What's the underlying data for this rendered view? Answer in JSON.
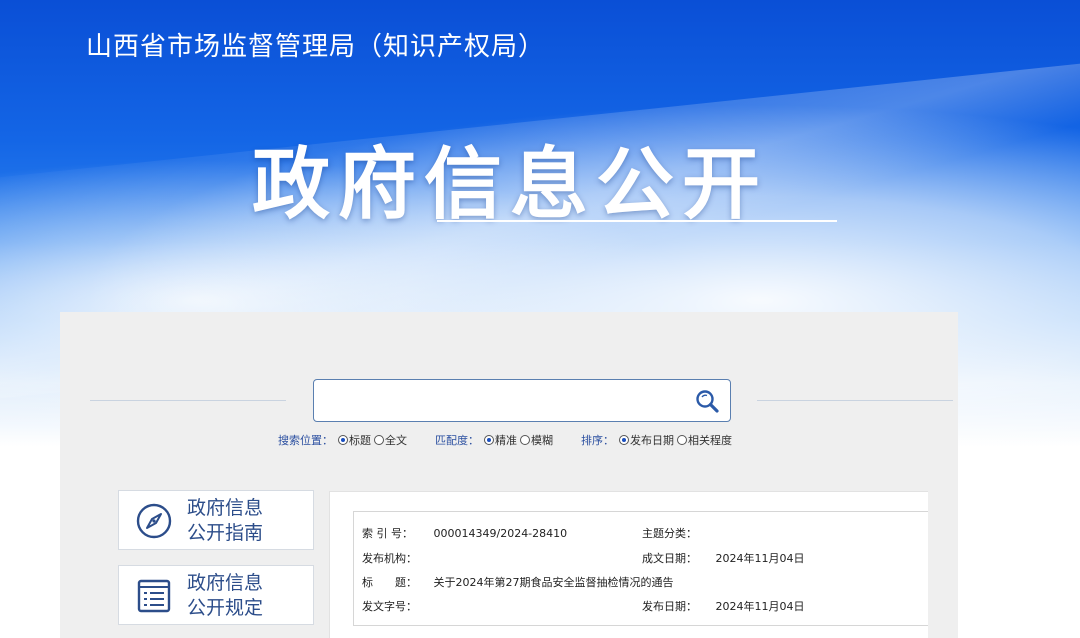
{
  "header": {
    "site_title": "山西省市场监督管理局（知识产权局）",
    "page_title": "政府信息公开"
  },
  "search": {
    "placeholder": "",
    "options": {
      "position_label": "搜索位置：",
      "position_items": [
        {
          "label": "标题",
          "selected": true
        },
        {
          "label": "全文",
          "selected": false
        }
      ],
      "match_label": "匹配度：",
      "match_items": [
        {
          "label": "精准",
          "selected": true
        },
        {
          "label": "模糊",
          "selected": false
        }
      ],
      "sort_label": "排序：",
      "sort_items": [
        {
          "label": "发布日期",
          "selected": true
        },
        {
          "label": "相关程度",
          "selected": false
        }
      ]
    }
  },
  "sidebar": {
    "items": [
      {
        "line1": "政府信息",
        "line2": "公开指南",
        "icon": "compass-icon"
      },
      {
        "line1": "政府信息",
        "line2": "公开规定",
        "icon": "document-list-icon"
      }
    ]
  },
  "detail": {
    "index_no_label": "索 引 号：",
    "index_no": "000014349/2024-28410",
    "topic_label": "主题分类：",
    "topic": "",
    "publisher_label": "发布机构：",
    "publisher": "",
    "written_date_label": "成文日期：",
    "written_date": "2024年11月04日",
    "title_label": "标　　题：",
    "title": "关于2024年第27期食品安全监督抽检情况的通告",
    "doc_no_label": "发文字号：",
    "doc_no": "",
    "publish_date_label": "发布日期：",
    "publish_date": "2024年11月04日"
  },
  "colors": {
    "brand_blue": "#1466e6",
    "label_blue": "#2c4d8a"
  }
}
